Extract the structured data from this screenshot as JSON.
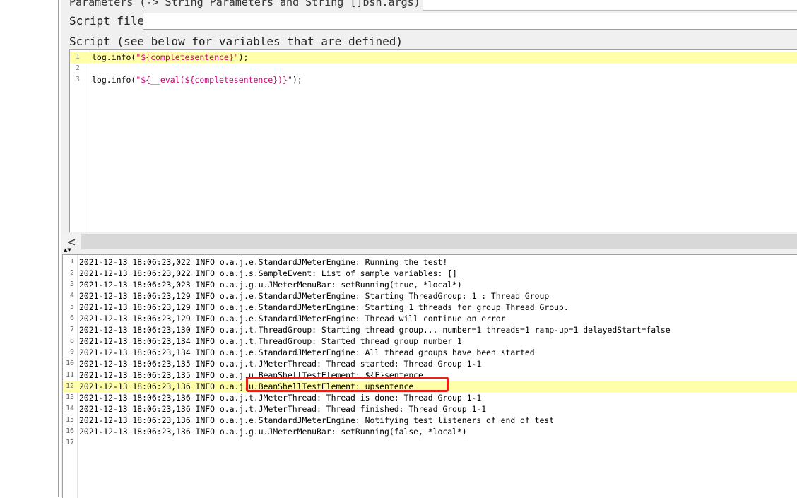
{
  "header": {
    "parameters_label": "Parameters (-> String Parameters and String []bsh.args)",
    "script_file_label": "Script file",
    "script_label": "Script (see below for variables that are defined)"
  },
  "editor": {
    "lines": [
      {
        "num": "1",
        "pre": "log.info(",
        "str": "\"${completesentence}\"",
        "post": ");",
        "active": true
      },
      {
        "num": "2",
        "pre": "",
        "str": "",
        "post": "",
        "active": false
      },
      {
        "num": "3",
        "pre": "log.info(",
        "str": "\"${__eval(${completesentence})}\"",
        "post": ");",
        "active": false
      }
    ]
  },
  "scrollbar": {
    "left_icon": "chevron-left-icon",
    "left_glyph": "<"
  },
  "splitter": {
    "icon": "split-arrows-icon",
    "glyph": "▲▼"
  },
  "log": {
    "lines": [
      {
        "num": "1",
        "text": "2021-12-13 18:06:23,022 INFO o.a.j.e.StandardJMeterEngine: Running the test!"
      },
      {
        "num": "2",
        "text": "2021-12-13 18:06:23,022 INFO o.a.j.s.SampleEvent: List of sample_variables: []"
      },
      {
        "num": "3",
        "text": "2021-12-13 18:06:23,023 INFO o.a.j.g.u.JMeterMenuBar: setRunning(true, *local*)"
      },
      {
        "num": "4",
        "text": "2021-12-13 18:06:23,129 INFO o.a.j.e.StandardJMeterEngine: Starting ThreadGroup: 1 : Thread Group"
      },
      {
        "num": "5",
        "text": "2021-12-13 18:06:23,129 INFO o.a.j.e.StandardJMeterEngine: Starting 1 threads for group Thread Group."
      },
      {
        "num": "6",
        "text": "2021-12-13 18:06:23,129 INFO o.a.j.e.StandardJMeterEngine: Thread will continue on error"
      },
      {
        "num": "7",
        "text": "2021-12-13 18:06:23,130 INFO o.a.j.t.ThreadGroup: Starting thread group... number=1 threads=1 ramp-up=1 delayedStart=false"
      },
      {
        "num": "8",
        "text": "2021-12-13 18:06:23,134 INFO o.a.j.t.ThreadGroup: Started thread group number 1"
      },
      {
        "num": "9",
        "text": "2021-12-13 18:06:23,134 INFO o.a.j.e.StandardJMeterEngine: All thread groups have been started"
      },
      {
        "num": "10",
        "text": "2021-12-13 18:06:23,135 INFO o.a.j.t.JMeterThread: Thread started: Thread Group 1-1"
      },
      {
        "num": "11",
        "text": "2021-12-13 18:06:23,135 INFO o.a.j.u.BeanShellTestElement: ${F}sentence"
      },
      {
        "num": "12",
        "text": "2021-12-13 18:06:23,136 INFO o.a.j.u.BeanShellTestElement: upsentence",
        "active": true
      },
      {
        "num": "13",
        "text": "2021-12-13 18:06:23,136 INFO o.a.j.t.JMeterThread: Thread is done: Thread Group 1-1"
      },
      {
        "num": "14",
        "text": "2021-12-13 18:06:23,136 INFO o.a.j.t.JMeterThread: Thread finished: Thread Group 1-1"
      },
      {
        "num": "15",
        "text": "2021-12-13 18:06:23,136 INFO o.a.j.e.StandardJMeterEngine: Notifying test listeners of end of test"
      },
      {
        "num": "16",
        "text": "2021-12-13 18:06:23,136 INFO o.a.j.g.u.JMeterMenuBar: setRunning(false, *local*)"
      },
      {
        "num": "17",
        "text": ""
      }
    ]
  },
  "colors": {
    "highlight_line": "#ffffaa",
    "string_literal": "#cc0077",
    "callout_border": "#e8231a"
  }
}
